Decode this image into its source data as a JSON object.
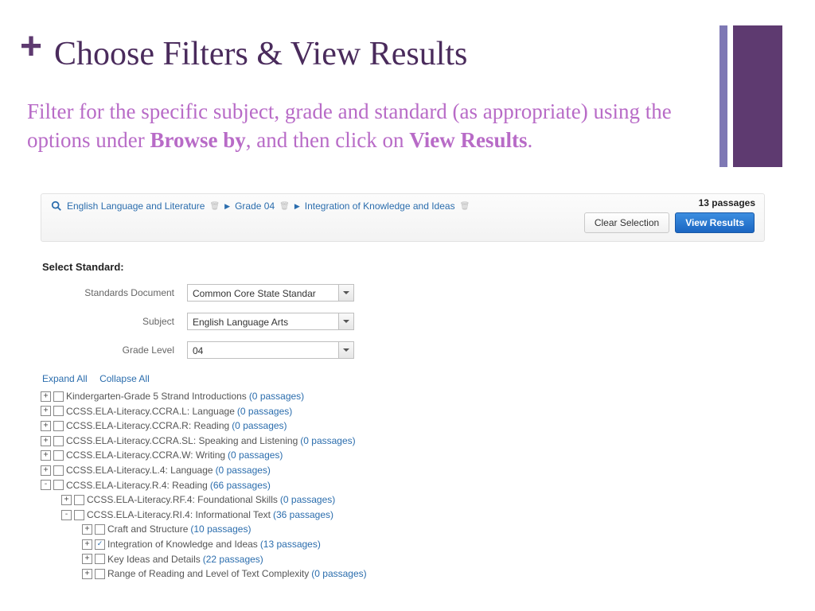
{
  "slide": {
    "title": "Choose Filters & View Results",
    "subtitle_pre": "Filter for the specific subject, grade and standard (as appropriate) using the options under ",
    "subtitle_bold1": "Browse by",
    "subtitle_mid": ", and then click on ",
    "subtitle_bold2": "View Results",
    "subtitle_post": "."
  },
  "breadcrumbs": {
    "b1": "English Language and Literature",
    "b2": "Grade 04",
    "b3": "Integration of Knowledge and Ideas"
  },
  "toolbar": {
    "count_num": "13",
    "count_word": " passages",
    "clear": "Clear Selection",
    "view": "View Results"
  },
  "form": {
    "header": "Select Standard:",
    "l1": "Standards Document",
    "v1": "Common Core State Standar",
    "l2": "Subject",
    "v2": "English Language Arts",
    "l3": "Grade Level",
    "v3": "04"
  },
  "treectrl": {
    "expand": "Expand All",
    "collapse": "Collapse All"
  },
  "tree": {
    "n1": {
      "label": "Kindergarten-Grade 5 Strand Introductions",
      "count": "(0 passages)"
    },
    "n2": {
      "label": "CCSS.ELA-Literacy.CCRA.L: Language",
      "count": "(0 passages)"
    },
    "n3": {
      "label": "CCSS.ELA-Literacy.CCRA.R: Reading",
      "count": "(0 passages)"
    },
    "n4": {
      "label": "CCSS.ELA-Literacy.CCRA.SL: Speaking and Listening",
      "count": "(0 passages)"
    },
    "n5": {
      "label": "CCSS.ELA-Literacy.CCRA.W: Writing",
      "count": "(0 passages)"
    },
    "n6": {
      "label": "CCSS.ELA-Literacy.L.4: Language",
      "count": "(0 passages)"
    },
    "n7": {
      "label": "CCSS.ELA-Literacy.R.4: Reading",
      "count": "(66 passages)"
    },
    "n7a": {
      "label": "CCSS.ELA-Literacy.RF.4: Foundational Skills",
      "count": "(0 passages)"
    },
    "n7b": {
      "label": "CCSS.ELA-Literacy.RI.4: Informational Text",
      "count": "(36 passages)"
    },
    "n7b1": {
      "label": "Craft and Structure",
      "count": "(10 passages)"
    },
    "n7b2": {
      "label": "Integration of Knowledge and Ideas",
      "count": "(13 passages)"
    },
    "n7b3": {
      "label": "Key Ideas and Details",
      "count": "(22 passages)"
    },
    "n7b4": {
      "label": "Range of Reading and Level of Text Complexity",
      "count": "(0 passages)"
    }
  }
}
